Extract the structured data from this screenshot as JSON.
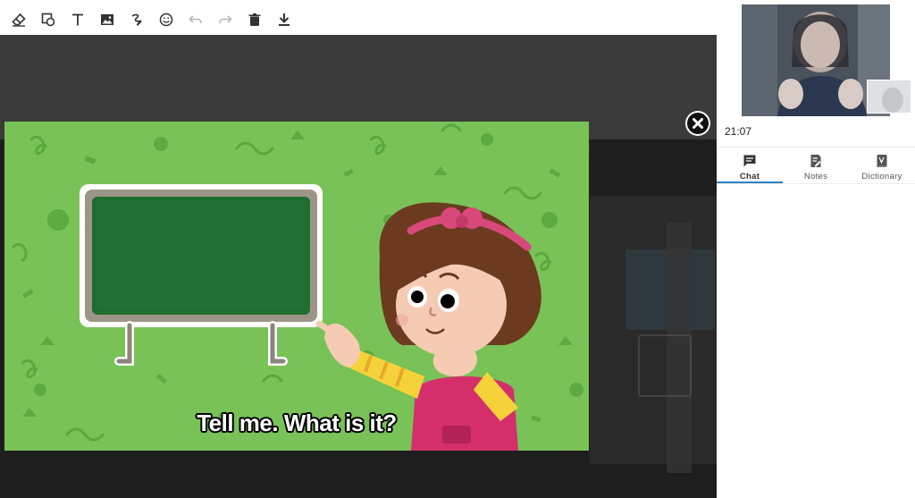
{
  "toolbar": {
    "tools": [
      {
        "name": "eraser-icon",
        "enabled": true
      },
      {
        "name": "shapes-icon",
        "enabled": true
      },
      {
        "name": "text-icon",
        "enabled": true
      },
      {
        "name": "image-icon",
        "enabled": true
      },
      {
        "name": "pen-icon",
        "enabled": true
      },
      {
        "name": "emoji-icon",
        "enabled": true
      },
      {
        "name": "undo-icon",
        "enabled": false
      },
      {
        "name": "redo-icon",
        "enabled": false
      },
      {
        "name": "trash-icon",
        "enabled": true
      },
      {
        "name": "download-icon",
        "enabled": true
      }
    ]
  },
  "video": {
    "subtitle": "Tell me. What is it?"
  },
  "session": {
    "timer": "21:07"
  },
  "tabs": [
    {
      "label": "Chat",
      "icon": "chat-icon",
      "active": true
    },
    {
      "label": "Notes",
      "icon": "notes-icon",
      "active": false
    },
    {
      "label": "Dictionary",
      "icon": "dictionary-icon",
      "active": false
    }
  ],
  "colors": {
    "accent": "#2f80c0",
    "scene_green": "#79c257",
    "chalkboard": "#1e6e32",
    "toolbar_icon": "#333333"
  }
}
